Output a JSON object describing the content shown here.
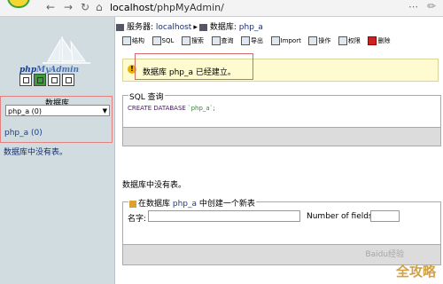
{
  "browser": {
    "url_host": "localhost",
    "url_path": "/phpMyAdmin/",
    "back_icon": "arrow-left",
    "forward_icon": "arrow-right",
    "refresh_icon": "refresh",
    "home_icon": "home"
  },
  "sidebar": {
    "logo_text_1": "php",
    "logo_text_2": "MyAdmin",
    "db_label": "数据库",
    "db_select_value": "php_a (0)",
    "db_link": "php_a (0)",
    "no_tables_note": "数据库中没有表。"
  },
  "breadcrumb": {
    "server_label": "服务器:",
    "server_value": "localhost",
    "db_label": "数据库:",
    "db_value": "php_a"
  },
  "tabs": [
    {
      "label": "结构",
      "icon": "structure-icon"
    },
    {
      "label": "SQL",
      "icon": "sql-icon"
    },
    {
      "label": "搜索",
      "icon": "search-icon"
    },
    {
      "label": "查询",
      "icon": "query-icon"
    },
    {
      "label": "导出",
      "icon": "export-icon"
    },
    {
      "label": "Import",
      "icon": "import-icon"
    },
    {
      "label": "操作",
      "icon": "operations-icon"
    },
    {
      "label": "权限",
      "icon": "privileges-icon"
    },
    {
      "label": "删除",
      "icon": "drop-icon"
    }
  ],
  "message": {
    "text": "数据库 php_a 已经建立。"
  },
  "sql_query": {
    "legend": "SQL 查询",
    "keyword": "CREATE DATABASE",
    "value": "`php_a`",
    "terminator": ";"
  },
  "main_note": "数据库中没有表。",
  "create_table": {
    "legend_prefix": "在数据库",
    "db_name": "php_a",
    "legend_suffix": "中创建一个新表",
    "name_label": "名字:",
    "name_value": "",
    "fields_label": "Number of fields:",
    "fields_value": ""
  },
  "watermark": {
    "small": "Baidu经验",
    "large": "全攻略"
  },
  "colors": {
    "sidebar_bg": "#d0dce0",
    "message_bg": "#fffbd0",
    "highlight_border": "#d46a6a",
    "sql_keyword": "#4b1470"
  }
}
